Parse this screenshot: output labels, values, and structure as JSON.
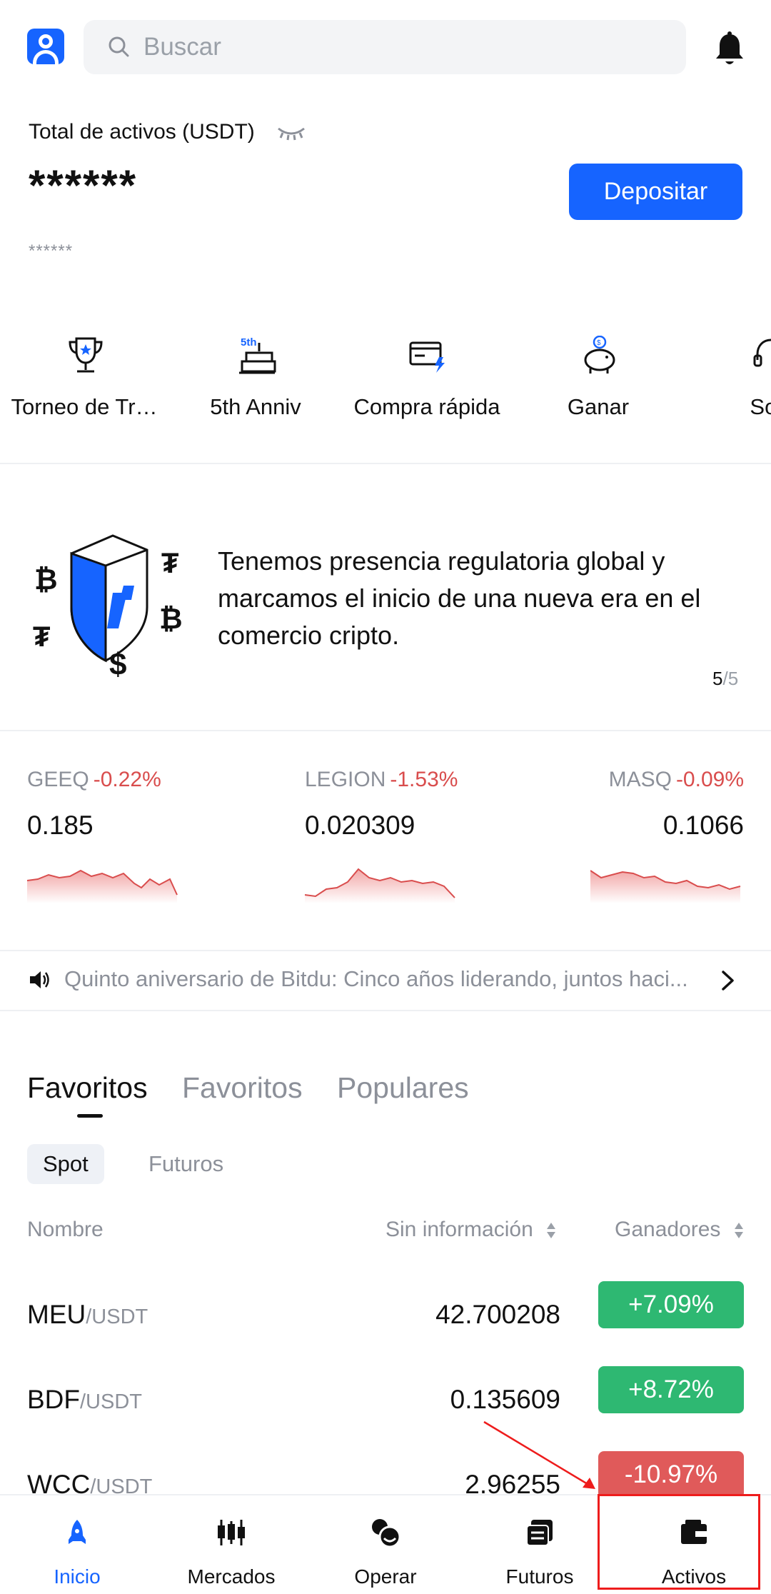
{
  "header": {
    "search_placeholder": "Buscar"
  },
  "assets": {
    "label": "Total de activos (USDT)",
    "value": "******",
    "sub_value": "******",
    "deposit_label": "Depositar"
  },
  "shortcuts": [
    {
      "label": "Torneo de Tr…",
      "icon": "trophy-icon"
    },
    {
      "label": "5th Anniv",
      "icon": "anniversary-cake-icon",
      "icon_text": "5th"
    },
    {
      "label": "Compra rápida",
      "icon": "quick-buy-card-icon"
    },
    {
      "label": "Ganar",
      "icon": "piggy-bank-icon"
    },
    {
      "label": "Sop",
      "icon": "support-headset-icon"
    }
  ],
  "banner": {
    "text": "Tenemos presencia regulatoria global y marcamos el inicio de una nueva era en el comercio cripto.",
    "page_current": "5",
    "page_separator": "/",
    "page_total": "5"
  },
  "tickers": [
    {
      "symbol": "GEEQ",
      "change": "-0.22%",
      "price": "0.185"
    },
    {
      "symbol": "LEGION",
      "change": "-1.53%",
      "price": "0.020309"
    },
    {
      "symbol": "MASQ",
      "change": "-0.09%",
      "price": "0.1066"
    }
  ],
  "announcement": {
    "text": "Quinto aniversario de Bitdu: Cinco años liderando, juntos haci..."
  },
  "tabs": [
    "Favoritos",
    "Favoritos",
    "Populares"
  ],
  "subtabs": [
    "Spot",
    "Futuros"
  ],
  "table": {
    "col_name": "Nombre",
    "col_price": "Sin información",
    "col_change": "Ganadores",
    "rows": [
      {
        "base": "MEU",
        "quote": "/USDT",
        "price": "42.700208",
        "change": "+7.09%",
        "direction": "up"
      },
      {
        "base": "BDF",
        "quote": "/USDT",
        "price": "0.135609",
        "change": "+8.72%",
        "direction": "up"
      },
      {
        "base": "WCC",
        "quote": "/USDT",
        "price": "2.96255",
        "change": "-10.97%",
        "direction": "down"
      }
    ]
  },
  "bottom_nav": [
    {
      "label": "Inicio",
      "icon": "home-rocket-icon",
      "active": true
    },
    {
      "label": "Mercados",
      "icon": "candlestick-icon",
      "active": false
    },
    {
      "label": "Operar",
      "icon": "trade-icon",
      "active": false
    },
    {
      "label": "Futuros",
      "icon": "futures-icon",
      "active": false
    },
    {
      "label": "Activos",
      "icon": "wallet-icon",
      "active": false
    }
  ],
  "colors": {
    "accent": "#1664ff",
    "up": "#2eb872",
    "down": "#e05a5a",
    "muted": "#8c9099",
    "annotation": "#ee1c1c"
  }
}
